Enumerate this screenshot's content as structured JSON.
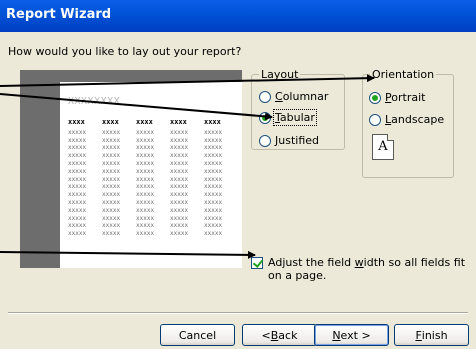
{
  "window": {
    "title": "Report Wizard"
  },
  "prompt": "How would you like to lay out your report?",
  "preview": {
    "header_placeholder": "XXXXXXXX",
    "column_headers": [
      "xxxx",
      "xxxx",
      "xxxx",
      "xxxx",
      "xxxx"
    ],
    "cell_text": "xxxxx",
    "row_count": 14
  },
  "layout": {
    "title": "Layout",
    "options": [
      {
        "label_pre": "",
        "accel": "C",
        "label_post": "olumnar",
        "selected": false
      },
      {
        "label_pre": "",
        "accel": "T",
        "label_post": "abular",
        "selected": true
      },
      {
        "label_pre": "",
        "accel": "J",
        "label_post": "ustified",
        "selected": false
      }
    ]
  },
  "orientation": {
    "title": "Orientation",
    "options": [
      {
        "label_pre": "",
        "accel": "P",
        "label_post": "ortrait",
        "selected": true
      },
      {
        "label_pre": "",
        "accel": "L",
        "label_post": "andscape",
        "selected": false
      }
    ],
    "page_icon_letter": "A"
  },
  "adjust_width": {
    "checked": true,
    "label_pre": "Adjust the field ",
    "accel": "w",
    "label_post": "idth so all fields fit on a page."
  },
  "buttons": {
    "cancel": "Cancel",
    "back_pre": "< ",
    "back_accel": "B",
    "back_post": "ack",
    "next_pre": "",
    "next_accel": "N",
    "next_post": "ext >",
    "finish_pre": "",
    "finish_accel": "F",
    "finish_post": "inish"
  },
  "colors": {
    "titlebar": "#0152d6",
    "dialog_bg": "#ece9d8",
    "preview_bg": "#6d6d6d",
    "radio_dot": "#21a121"
  }
}
